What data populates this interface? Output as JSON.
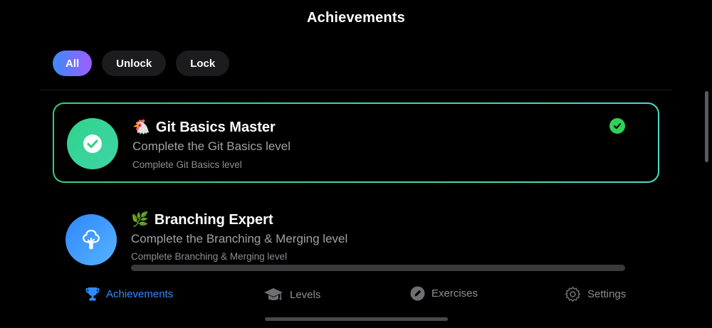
{
  "header": {
    "title": "Achievements"
  },
  "filters": [
    {
      "label": "All",
      "active": true
    },
    {
      "label": "Unlock",
      "active": false
    },
    {
      "label": "Lock",
      "active": false
    }
  ],
  "achievements": [
    {
      "emoji": "🐔",
      "title": "Git Basics Master",
      "description": "Complete the Git Basics level",
      "requirement": "Complete Git Basics level",
      "unlocked": true,
      "icon": "checkmark-icon"
    },
    {
      "emoji": "🌿",
      "title": "Branching Expert",
      "description": "Complete the Branching & Merging level",
      "requirement": "Complete Branching & Merging level",
      "unlocked": false,
      "progress": 0,
      "icon": "tree-icon"
    }
  ],
  "tabs": [
    {
      "label": "Achievements",
      "icon": "trophy-icon",
      "active": true
    },
    {
      "label": "Levels",
      "icon": "graduation-cap-icon",
      "active": false
    },
    {
      "label": "Exercises",
      "icon": "pencil-icon",
      "active": false
    },
    {
      "label": "Settings",
      "icon": "gear-icon",
      "active": false
    }
  ],
  "colors": {
    "accent": "#2f8cff",
    "unlocked_gradient_start": "#34d27a",
    "unlocked_gradient_end": "#4fd9c9",
    "chip_active_start": "#3b8bff",
    "chip_active_end": "#a05cff"
  }
}
